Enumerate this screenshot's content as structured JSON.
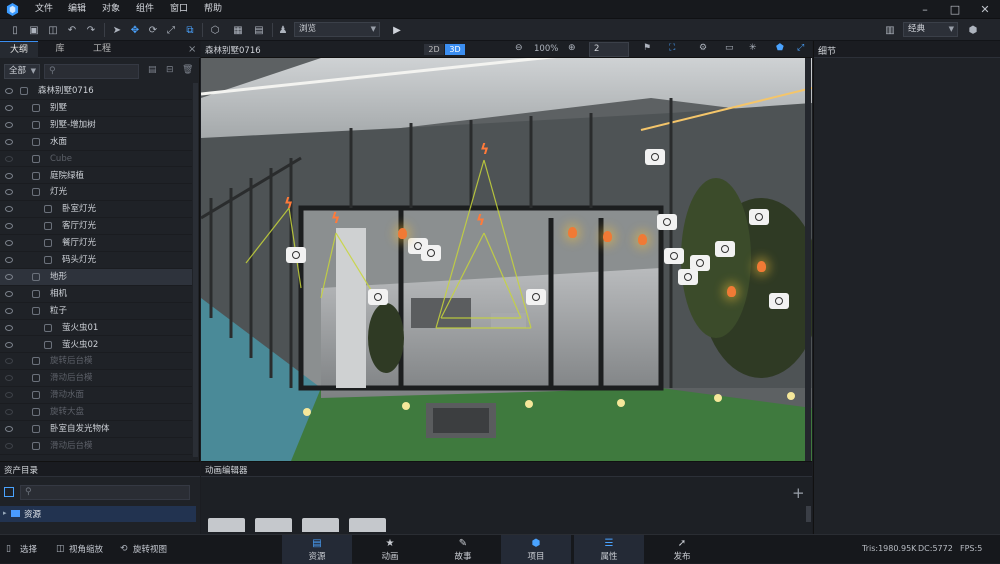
{
  "menu": {
    "items": [
      "文件",
      "编辑",
      "对象",
      "组件",
      "窗口",
      "帮助"
    ]
  },
  "toolbar": {
    "view_mode": "浏览",
    "layout": "经典"
  },
  "left_panel": {
    "tabs": [
      "大纲",
      "库",
      "工程"
    ],
    "filter": "全部",
    "tree": [
      {
        "label": "森林别墅0716",
        "level": 0,
        "dim": false
      },
      {
        "label": "别墅",
        "level": 1,
        "dim": false
      },
      {
        "label": "别墅-增加树",
        "level": 1,
        "dim": false
      },
      {
        "label": "水面",
        "level": 1,
        "dim": false
      },
      {
        "label": "Cube",
        "level": 1,
        "dim": true
      },
      {
        "label": "庭院绿植",
        "level": 1,
        "dim": false
      },
      {
        "label": "灯光",
        "level": 1,
        "dim": false
      },
      {
        "label": "卧室灯光",
        "level": 2,
        "dim": false
      },
      {
        "label": "客厅灯光",
        "level": 2,
        "dim": false
      },
      {
        "label": "餐厅灯光",
        "level": 2,
        "dim": false
      },
      {
        "label": "码头灯光",
        "level": 2,
        "dim": false
      },
      {
        "label": "地形",
        "level": 1,
        "dim": false,
        "selected": true
      },
      {
        "label": "相机",
        "level": 1,
        "dim": false
      },
      {
        "label": "粒子",
        "level": 1,
        "dim": false
      },
      {
        "label": "萤火虫01",
        "level": 2,
        "dim": false
      },
      {
        "label": "萤火虫02",
        "level": 2,
        "dim": false
      },
      {
        "label": "旋转后台模",
        "level": 1,
        "dim": true
      },
      {
        "label": "滑动后台模",
        "level": 1,
        "dim": true
      },
      {
        "label": "滑动水面",
        "level": 1,
        "dim": true
      },
      {
        "label": "旋转大盘",
        "level": 1,
        "dim": true
      },
      {
        "label": "卧室自发光物体",
        "level": 1,
        "dim": false
      },
      {
        "label": "滑动后台模",
        "level": 1,
        "dim": true
      }
    ]
  },
  "viewport": {
    "title": "森林别墅0716",
    "mode_2d": "2D",
    "mode_3d": "3D",
    "zoom": "100%",
    "count": "2"
  },
  "right_panel": {
    "title": "细节"
  },
  "asset_panel": {
    "title": "资产目录",
    "root": "资源"
  },
  "anim_panel": {
    "title": "动画编辑器"
  },
  "status": {
    "tools": [
      "选择",
      "视角缩放",
      "旋转视图"
    ],
    "tabs": [
      "资源",
      "动画",
      "故事",
      "项目",
      "属性",
      "发布"
    ],
    "tris": "Tris:1980.95K",
    "dc": "DC:5772",
    "fps": "FPS:5"
  },
  "colors": {
    "accent": "#3b8ef0",
    "panel": "#1f2227",
    "light": "#f07a35"
  }
}
